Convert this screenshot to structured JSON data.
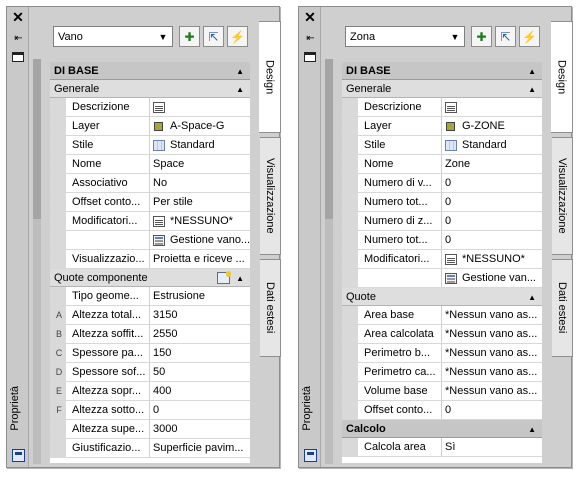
{
  "palettes": [
    {
      "title": "Proprietà",
      "object_type": "Vano",
      "tabs": [
        "Design",
        "Visualizzazione",
        "Dati estesi"
      ],
      "categories": [
        {
          "name": "DI BASE",
          "groups": [
            {
              "name": "Generale",
              "rows": [
                {
                  "label": "Descrizione",
                  "icon": "document-icon",
                  "value": ""
                },
                {
                  "label": "Layer",
                  "icon": "layer-color-icon",
                  "value": "A-Space-G"
                },
                {
                  "label": "Stile",
                  "icon": "style-icon",
                  "value": "Standard"
                },
                {
                  "label": "Nome",
                  "value": "Space"
                },
                {
                  "label": "Associativo",
                  "value": "No"
                },
                {
                  "label": "Offset conto...",
                  "value": "Per stile"
                },
                {
                  "label": "Modificatori...",
                  "icon": "document-icon",
                  "value": "*NESSUNO*"
                },
                {
                  "label": "",
                  "icon": "classification-icon",
                  "value": "Gestione vano..."
                },
                {
                  "label": "Visualizzazio...",
                  "value": "Proietta e riceve ..."
                }
              ]
            },
            {
              "name": "Quote componente",
              "has_icon": true,
              "rows": [
                {
                  "label": "Tipo geome...",
                  "value": "Estrusione"
                },
                {
                  "letter": "A",
                  "label": "Altezza total...",
                  "value": "3150"
                },
                {
                  "letter": "B",
                  "label": "Altezza soffit...",
                  "value": "2550"
                },
                {
                  "letter": "C",
                  "label": "Spessore pa...",
                  "value": "150"
                },
                {
                  "letter": "D",
                  "label": "Spessore sof...",
                  "value": "50"
                },
                {
                  "letter": "E",
                  "label": "Altezza sopr...",
                  "value": "400"
                },
                {
                  "letter": "F",
                  "label": "Altezza sotto...",
                  "value": "0"
                },
                {
                  "label": "Altezza supe...",
                  "value": "3000"
                },
                {
                  "label": "Giustificazio...",
                  "value": "Superficie pavim..."
                }
              ]
            }
          ]
        }
      ]
    },
    {
      "title": "Proprietà",
      "object_type": "Zona",
      "tabs": [
        "Design",
        "Visualizzazione",
        "Dati estesi"
      ],
      "categories": [
        {
          "name": "DI BASE",
          "groups": [
            {
              "name": "Generale",
              "rows": [
                {
                  "label": "Descrizione",
                  "icon": "document-icon",
                  "value": ""
                },
                {
                  "label": "Layer",
                  "icon": "layer-color-icon",
                  "value": "G-ZONE"
                },
                {
                  "label": "Stile",
                  "icon": "style-icon",
                  "value": "Standard"
                },
                {
                  "label": "Nome",
                  "value": "Zone"
                },
                {
                  "label": "Numero di v...",
                  "value": "0"
                },
                {
                  "label": "Numero tot...",
                  "value": "0"
                },
                {
                  "label": "Numero di z...",
                  "value": "0"
                },
                {
                  "label": "Numero tot...",
                  "value": "0"
                },
                {
                  "label": "Modificatori...",
                  "icon": "document-icon",
                  "value": "*NESSUNO*"
                },
                {
                  "label": "",
                  "icon": "classification-icon",
                  "value": "Gestione van..."
                }
              ]
            },
            {
              "name": "Quote",
              "rows": [
                {
                  "label": "Area base",
                  "value": "*Nessun vano as..."
                },
                {
                  "label": "Area calcolata",
                  "value": "*Nessun vano as..."
                },
                {
                  "label": "Perimetro b...",
                  "value": "*Nessun vano as..."
                },
                {
                  "label": "Perimetro ca...",
                  "value": "*Nessun vano as..."
                },
                {
                  "label": "Volume base",
                  "value": "*Nessun vano as..."
                },
                {
                  "label": "Offset conto...",
                  "value": "0"
                }
              ]
            }
          ]
        },
        {
          "name": "Calcolo",
          "groups": [
            {
              "name": "",
              "rows": [
                {
                  "label": "Calcola area",
                  "value": "Sì"
                }
              ]
            }
          ]
        }
      ]
    }
  ],
  "titlebar": {
    "close": "✕",
    "autohide": "⇤",
    "collapse_arrow": "▲",
    "dropdown_arrow": "▼"
  },
  "colors": {
    "palette_bg": "#cfcfcf",
    "category_bg": "#c6c6c6",
    "group_bg": "#dedede",
    "layer_swatch": "#a7a63b"
  }
}
